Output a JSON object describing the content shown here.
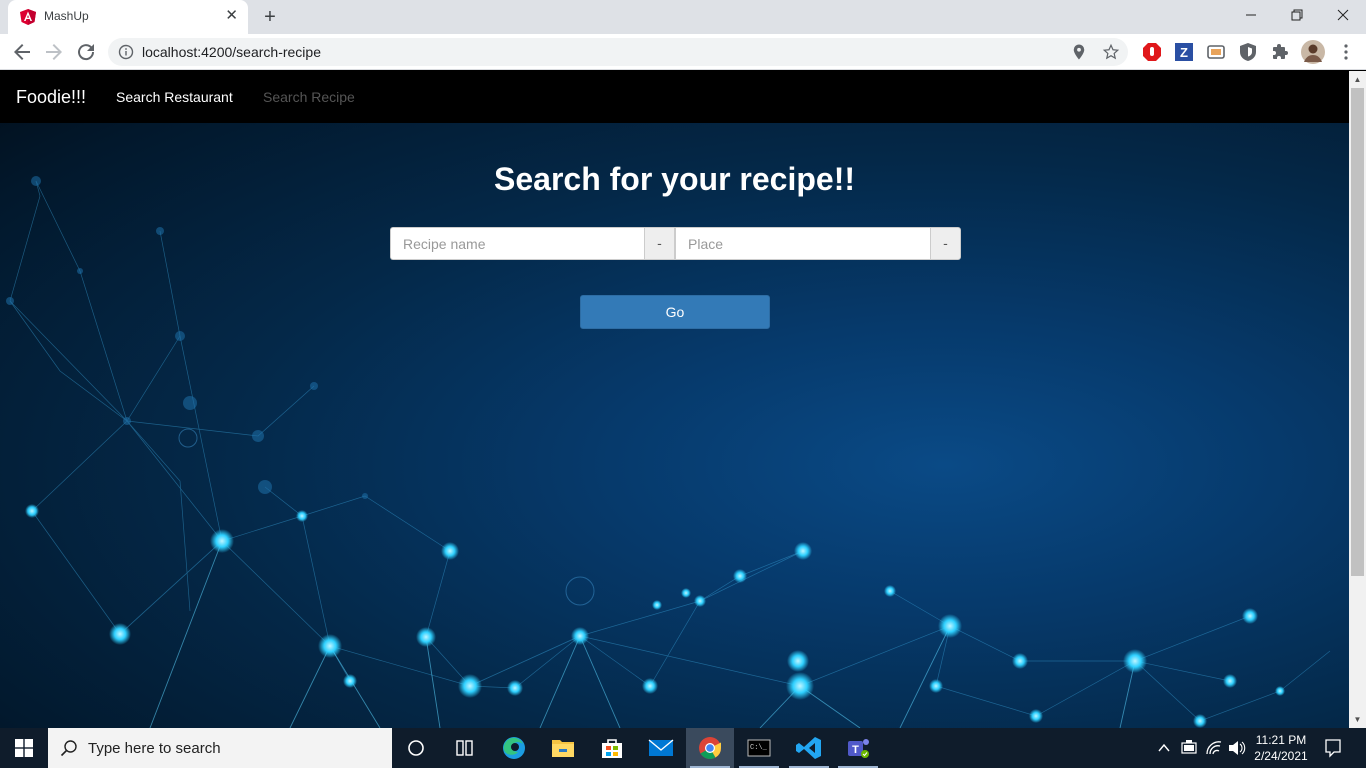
{
  "browser": {
    "tab_title": "MashUp",
    "tab_close": "✕",
    "new_tab": "+",
    "url": "localhost:4200/search-recipe",
    "window_controls": {
      "minimize": "—",
      "restore": "❐",
      "close": "✕"
    },
    "icons": [
      "back-icon",
      "forward-icon",
      "reload-icon",
      "info-icon",
      "location-icon",
      "star-icon",
      "extensions-icon",
      "profile-avatar",
      "menu-icon"
    ]
  },
  "navbar": {
    "brand": "Foodie!!!",
    "links": [
      {
        "label": "Search Restaurant",
        "active": false
      },
      {
        "label": "Search Recipe",
        "active": true
      }
    ]
  },
  "main": {
    "title": "Search for your recipe!!",
    "recipe_input": {
      "placeholder": "Recipe name",
      "value": ""
    },
    "recipe_addon": "-",
    "place_input": {
      "placeholder": "Place",
      "value": ""
    },
    "place_addon": "-",
    "go_label": "Go"
  },
  "taskbar": {
    "search_placeholder": "Type here to search",
    "time": "11:21 PM",
    "date": "2/24/2021",
    "apps": [
      "cortana-icon",
      "task-view-icon",
      "edge-icon",
      "file-explorer-icon",
      "store-icon",
      "mail-icon",
      "chrome-icon",
      "terminal-icon",
      "vscode-icon",
      "teams-icon"
    ]
  },
  "colors": {
    "navbar": "#000000",
    "button": "#337ab7",
    "nav_active": "#555555",
    "taskbar": "#0f1c2b"
  }
}
